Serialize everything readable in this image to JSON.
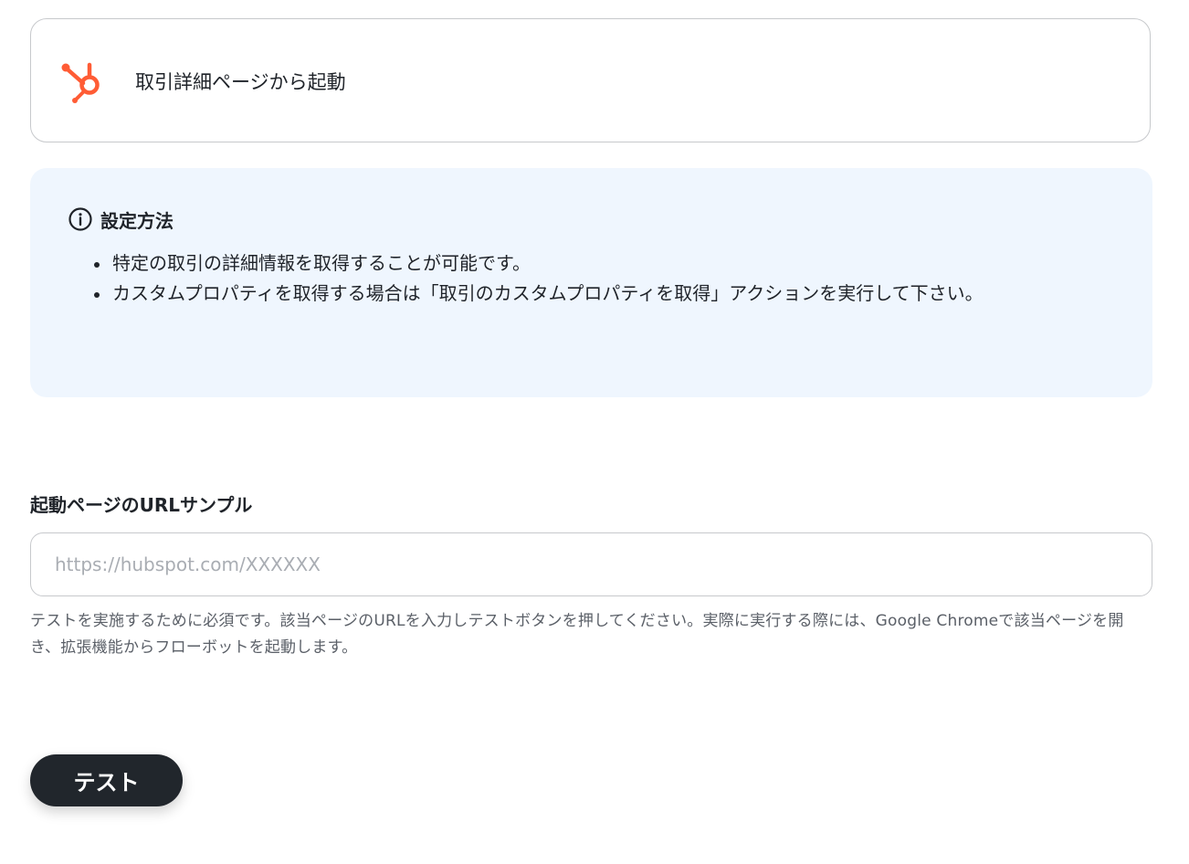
{
  "trigger": {
    "icon": "hubspot-icon",
    "title": "取引詳細ページから起動"
  },
  "info": {
    "icon": "info-circle-icon",
    "title": "設定方法",
    "items": [
      "特定の取引の詳細情報を取得することが可能です。",
      "カスタムプロパティを取得する場合は「取引のカスタムプロパティを取得」アクションを実行して下さい。"
    ]
  },
  "url_field": {
    "label": "起動ページのURLサンプル",
    "placeholder": "https://hubspot.com/XXXXXX",
    "value": "",
    "help": "テストを実施するために必須です。該当ページのURLを入力しテストボタンを押してください。実際に実行する際には、Google Chromeで該当ページを開き、拡張機能からフローボットを起動します。"
  },
  "test_button": {
    "label": "テスト"
  },
  "colors": {
    "hubspot_orange": "#ff5c35",
    "info_background": "#eff6fe",
    "button_background": "#21262c"
  }
}
